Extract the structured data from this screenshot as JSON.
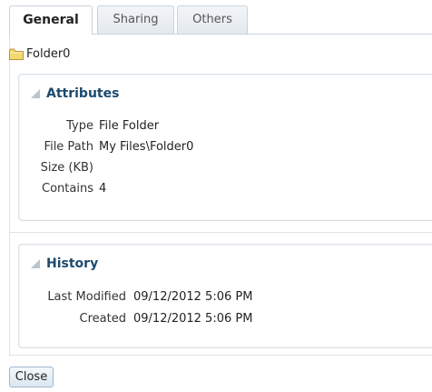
{
  "tabs": [
    {
      "label": "General",
      "active": true
    },
    {
      "label": "Sharing",
      "active": false
    },
    {
      "label": "Others",
      "active": false
    }
  ],
  "folder": {
    "name": "Folder0",
    "icon": "folder-icon",
    "icon_color": "#f2d772"
  },
  "attributes": {
    "title": "Attributes",
    "rows": [
      {
        "label": "Type",
        "value": "File Folder"
      },
      {
        "label": "File Path",
        "value": "My Files\\Folder0"
      },
      {
        "label": "Size (KB)",
        "value": ""
      },
      {
        "label": "Contains",
        "value": "4"
      }
    ]
  },
  "history": {
    "title": "History",
    "rows": [
      {
        "label": "Last Modified",
        "value": "09/12/2012 5:06 PM"
      },
      {
        "label": "Created",
        "value": "09/12/2012 5:06 PM"
      }
    ]
  },
  "footer": {
    "close_label": "Close"
  },
  "colors": {
    "section_title": "#1b4a6e",
    "border": "#c9d3dc",
    "button_border": "#9fb6cc"
  }
}
